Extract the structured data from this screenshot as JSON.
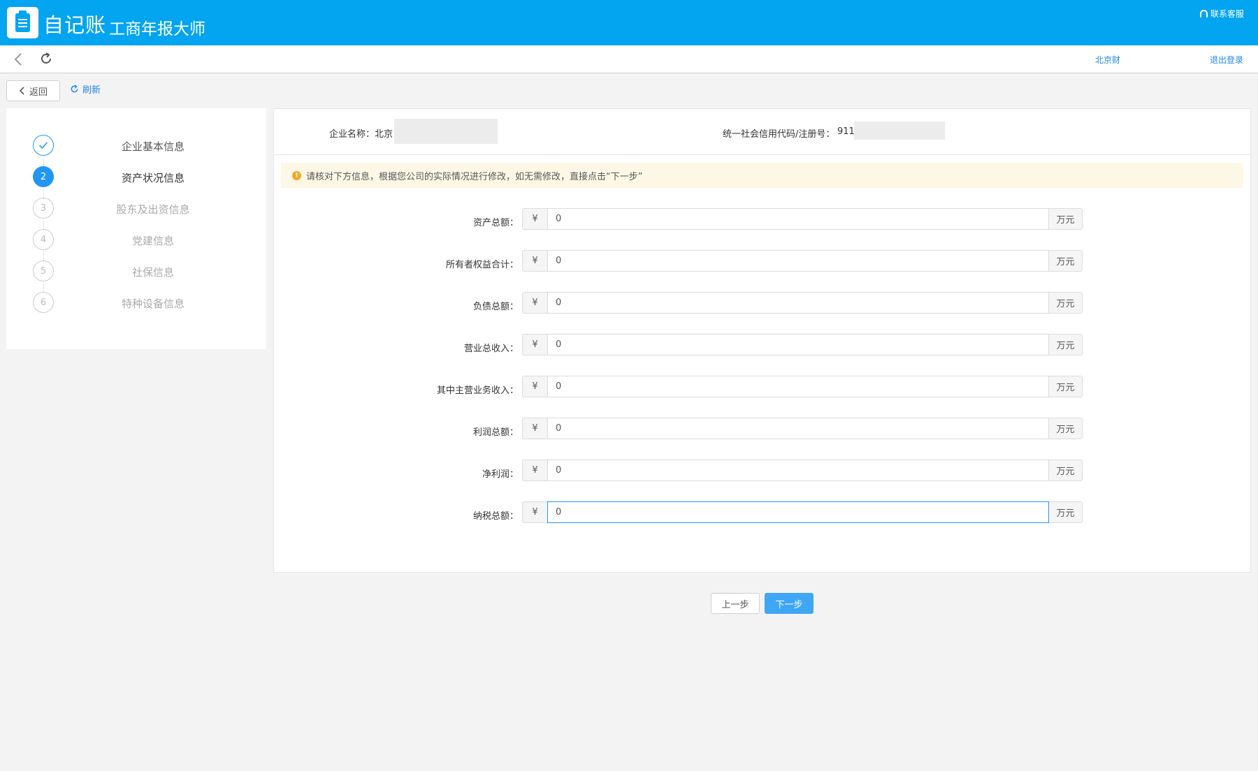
{
  "header": {
    "app_name": "自记账",
    "app_subtitle": "工商年报大师",
    "support_label": "联系客服"
  },
  "navbar": {
    "city": "北京财",
    "logout": "退出登录"
  },
  "toolbar": {
    "return_label": "返回",
    "refresh_label": "刷新"
  },
  "steps": [
    {
      "number": "1",
      "label": "企业基本信息",
      "status": "done"
    },
    {
      "number": "2",
      "label": "资产状况信息",
      "status": "active"
    },
    {
      "number": "3",
      "label": "股东及出资信息",
      "status": "pending"
    },
    {
      "number": "4",
      "label": "党建信息",
      "status": "pending"
    },
    {
      "number": "5",
      "label": "社保信息",
      "status": "pending"
    },
    {
      "number": "6",
      "label": "特种设备信息",
      "status": "pending"
    }
  ],
  "company": {
    "name_label": "企业名称：",
    "name_value": "北京",
    "code_label": "统一社会信用代码/注册号：",
    "code_value": "911"
  },
  "notice": {
    "icon": "!",
    "text": "请核对下方信息，根据您公司的实际情况进行修改，如无需修改，直接点击“下一步”"
  },
  "form": {
    "prefix": "¥",
    "suffix": "万元",
    "fields": [
      {
        "label": "资产总额：",
        "value": "0"
      },
      {
        "label": "所有者权益合计：",
        "value": "0"
      },
      {
        "label": "负债总额：",
        "value": "0"
      },
      {
        "label": "营业总收入：",
        "value": "0"
      },
      {
        "label": "其中主营业务收入：",
        "value": "0"
      },
      {
        "label": "利润总额：",
        "value": "0"
      },
      {
        "label": "净利润：",
        "value": "0"
      },
      {
        "label": "纳税总额：",
        "value": "0"
      }
    ]
  },
  "actions": {
    "prev_label": "上一步",
    "next_label": "下一步"
  },
  "colors": {
    "brand": "#03a4f0",
    "accent": "#2196f3",
    "notice_bg": "#fdf8e6",
    "notice_icon": "#f5a623"
  }
}
